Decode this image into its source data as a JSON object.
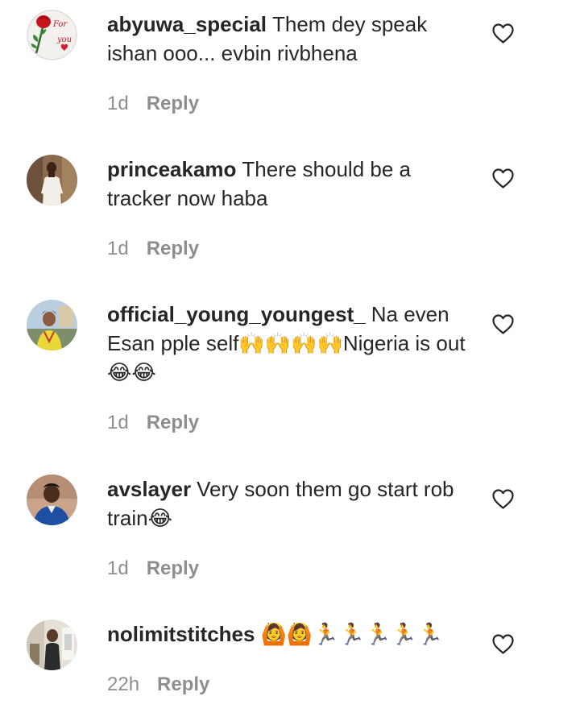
{
  "comments": [
    {
      "username": "abyuwa_special",
      "text": "Them dey speak ishan ooo... evbin rivbhena",
      "time": "1d",
      "reply_label": "Reply",
      "avatar_text_1": "For",
      "avatar_text_2": "you"
    },
    {
      "username": "princeakamo",
      "text": "There should be a tracker now haba",
      "time": "1d",
      "reply_label": "Reply"
    },
    {
      "username": "official_young_youngest_",
      "text": "Na even Esan pple self🙌🙌🙌🙌Nigeria is out😂😂",
      "time": "1d",
      "reply_label": "Reply"
    },
    {
      "username": "avslayer",
      "text": "Very soon them go start rob train😂",
      "time": "1d",
      "reply_label": "Reply"
    },
    {
      "username": "nolimitstitches",
      "text": "🙆🙆🏃🏃🏃🏃🏃",
      "time": "22h",
      "reply_label": "Reply"
    }
  ],
  "icons": {
    "like": "heart-outline-icon"
  },
  "colors": {
    "text": "#262626",
    "secondary": "#8e8e8e",
    "background": "#ffffff"
  }
}
